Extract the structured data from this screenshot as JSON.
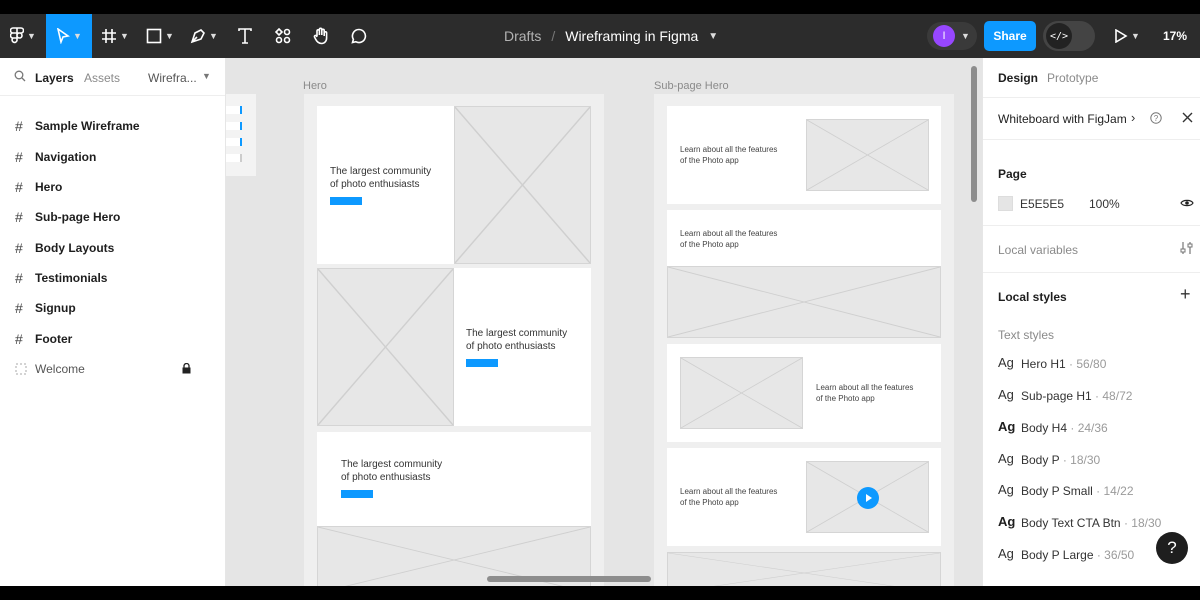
{
  "toolbar": {
    "breadcrumb_project": "Drafts",
    "breadcrumb_separator": "/",
    "file_name": "Wireframing in Figma",
    "avatar_initial": "I",
    "share_label": "Share",
    "dev_mode_glyph": "</>",
    "zoom": "17%",
    "icons": [
      "figma-menu-icon",
      "move-tool-icon",
      "frame-tool-icon",
      "shape-tool-icon",
      "pen-tool-icon",
      "text-tool-icon",
      "resources-icon",
      "hand-tool-icon",
      "comment-icon",
      "present-icon"
    ]
  },
  "left_panel": {
    "tabs": {
      "layers": "Layers",
      "assets": "Assets",
      "page": "Wirefra..."
    },
    "layers": [
      {
        "label": "Sample Wireframe"
      },
      {
        "label": "Navigation"
      },
      {
        "label": "Hero"
      },
      {
        "label": "Sub-page Hero"
      },
      {
        "label": "Body Layouts"
      },
      {
        "label": "Testimonials"
      },
      {
        "label": "Signup"
      },
      {
        "label": "Footer"
      },
      {
        "label": "Welcome",
        "locked": true
      }
    ]
  },
  "canvas": {
    "hero_frame_label": "Hero",
    "subpage_frame_label": "Sub-page Hero",
    "hero_headline_line1": "The largest community",
    "hero_headline_line2": "of photo enthusiasts",
    "feature_line1": "Learn about all the features",
    "feature_line2": "of the Photo app"
  },
  "right_panel": {
    "tabs": {
      "design": "Design",
      "prototype": "Prototype"
    },
    "whiteboard_label": "Whiteboard with FigJam",
    "page_section": "Page",
    "page_color": "E5E5E5",
    "page_opacity": "100%",
    "local_variables": "Local variables",
    "local_styles": "Local styles",
    "text_styles_label": "Text styles",
    "text_styles": [
      {
        "ag": "Ag",
        "name": "Hero H1",
        "meta": " · 56/80",
        "bold": false
      },
      {
        "ag": "Ag",
        "name": "Sub-page H1",
        "meta": " · 48/72",
        "bold": false
      },
      {
        "ag": "Ag",
        "name": "Body H4",
        "meta": " · 24/36",
        "bold": true
      },
      {
        "ag": "Ag",
        "name": "Body P",
        "meta": " · 18/30",
        "bold": false
      },
      {
        "ag": "Ag",
        "name": "Body P Small",
        "meta": " · 14/22",
        "bold": false
      },
      {
        "ag": "Ag",
        "name": "Body Text CTA Btn",
        "meta": " · 18/30",
        "bold": true
      },
      {
        "ag": "Ag",
        "name": "Body P Large",
        "meta": " · 36/50",
        "bold": false
      }
    ],
    "help_glyph": "?"
  },
  "colors": {
    "accent": "#0d99ff",
    "toolbar_bg": "#2c2c2c",
    "canvas_bg": "#e5e5e5"
  }
}
